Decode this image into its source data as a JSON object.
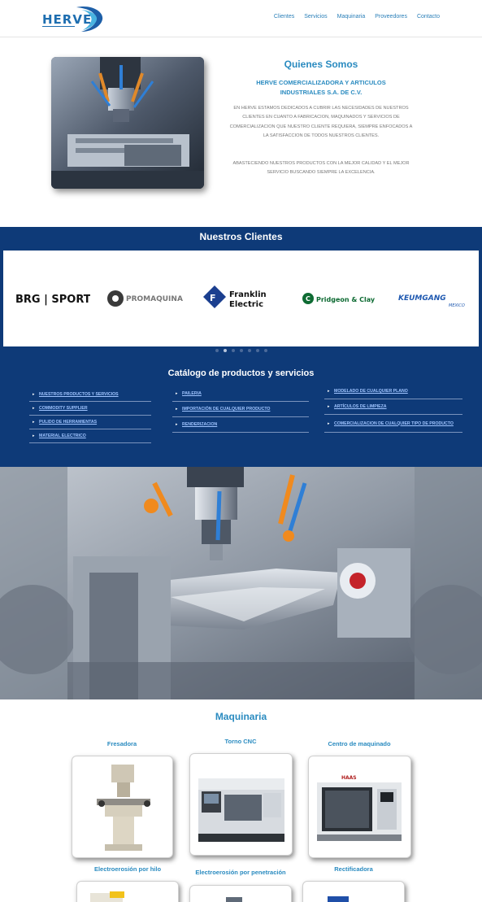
{
  "header": {
    "logo_text": "HERVE",
    "nav": [
      "Clientes",
      "Servicios",
      "Maquinaria",
      "Proveedores",
      "Contacto"
    ]
  },
  "about": {
    "title": "Quienes Somos",
    "subtitle": "HERVE COMERCIALIZADORA Y ARTICULOS INDUSTRIALES S.A. DE C.V.",
    "paragraph1": "EN HERVE ESTAMOS DEDICADOS A CUBRIR LAS NECESIDADES DE NUESTROS CLIENTES EN CUANTO A FABRICACION, MAQUINADOS Y SERVICIOS DE COMERCIALIZACION QUE NUESTRO CLIENTE REQUIERA, SIEMPRE ENFOCADOS A LA SATISFACCION DE TODOS NUESTROS CLIENTES.",
    "paragraph2": "ABASTECIENDO NUESTROS PRODUCTOS CON LA MEJOR CALIDAD Y EL MEJOR SERVICIO BUSCANDO SIEMPRE LA EXCELENCIA."
  },
  "clients": {
    "title": "Nuestros Clientes",
    "logos": [
      "BRG | SPORTS",
      "PROMAQUINA",
      "Franklin Electric",
      "Pridgeon & Clay",
      "KEUMGANG MEXICO"
    ],
    "dot_count": 7,
    "active_dot": 1
  },
  "catalog": {
    "title": "Catálogo de productos y servicios",
    "col1": [
      "NUESTROS PRODUCTOS Y SERVICIOS",
      "COMMODITY SUPPLIER",
      "PULIDO DE HERRAMIENTAS",
      "MATERIAL ELECTRICO"
    ],
    "col2": [
      "PAILERIA",
      "IMPORTACIÓN DE CUALQUIER PRODUCTO",
      "RENDERIZACION"
    ],
    "col3": [
      "MODELADO DE CUALQUIER PLANO",
      "ARTÍCULOS DE LIMPIEZA",
      "COMERCIALIZACION DE CUALQUIER TIPO DE PRODUCTO"
    ]
  },
  "machinery": {
    "title": "Maquinaria",
    "items": [
      "Fresadora",
      "Torno CNC",
      "Centro de maquinado",
      "Electroerosión por hilo",
      "Electroerosión por penetración",
      "Rectificadora"
    ]
  },
  "colors": {
    "accent": "#2a8bc0",
    "navy": "#0e3a78",
    "link_light": "#9fc4ff"
  }
}
